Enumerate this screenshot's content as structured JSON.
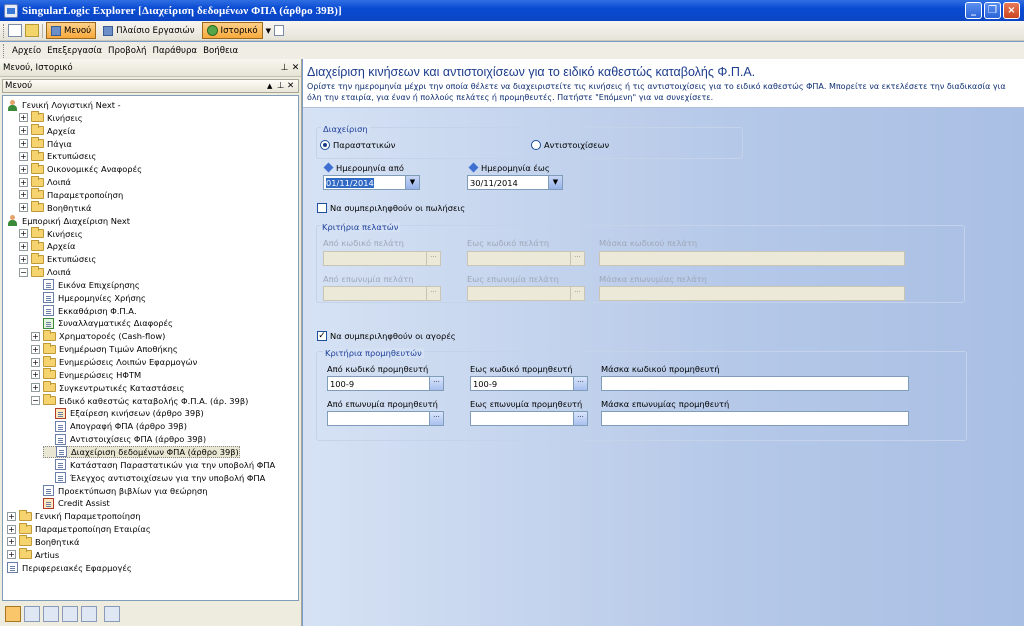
{
  "window": {
    "title": "SingularLogic Explorer [Διαχείριση δεδομένων ΦΠΑ (άρθρο 39Β)]"
  },
  "toolbar": {
    "menu_btn": "Μενού",
    "workspace_btn": "Πλαίσιο Εργασιών",
    "history_btn": "Ιστορικό"
  },
  "menubar": [
    "Αρχείο",
    "Επεξεργασία",
    "Προβολή",
    "Παράθυρα",
    "Βοήθεια"
  ],
  "leftpanel": {
    "header": "Μενού, Ιστορικό",
    "subheader": "Μενού",
    "tree": [
      {
        "label": "Γενική Λογιστική Next -",
        "icon": "person",
        "lvl": 0,
        "exp": ""
      },
      {
        "label": "Κινήσεις",
        "icon": "folder",
        "lvl": 1,
        "exp": "+"
      },
      {
        "label": "Αρχεία",
        "icon": "folder",
        "lvl": 1,
        "exp": "+"
      },
      {
        "label": "Πάγια",
        "icon": "folder",
        "lvl": 1,
        "exp": "+"
      },
      {
        "label": "Εκτυπώσεις",
        "icon": "folder",
        "lvl": 1,
        "exp": "+"
      },
      {
        "label": "Οικονομικές Αναφορές",
        "icon": "folder",
        "lvl": 1,
        "exp": "+"
      },
      {
        "label": "Λοιπά",
        "icon": "folder",
        "lvl": 1,
        "exp": "+"
      },
      {
        "label": "Παραμετροποίηση",
        "icon": "folder",
        "lvl": 1,
        "exp": "+"
      },
      {
        "label": "Βοηθητικά",
        "icon": "folder",
        "lvl": 1,
        "exp": "+"
      },
      {
        "label": "Εμπορική Διαχείριση Next",
        "icon": "person",
        "lvl": 0,
        "exp": ""
      },
      {
        "label": "Κινήσεις",
        "icon": "folder",
        "lvl": 1,
        "exp": "+"
      },
      {
        "label": "Αρχεία",
        "icon": "folder",
        "lvl": 1,
        "exp": "+"
      },
      {
        "label": "Εκτυπώσεις",
        "icon": "folder",
        "lvl": 1,
        "exp": "+"
      },
      {
        "label": "Λοιπά",
        "icon": "folder",
        "lvl": 1,
        "exp": "−"
      },
      {
        "label": "Εικόνα Επιχείρησης",
        "icon": "doc",
        "lvl": 2,
        "exp": ""
      },
      {
        "label": "Ημερομηνίες Χρήσης",
        "icon": "doc",
        "lvl": 2,
        "exp": ""
      },
      {
        "label": "Εκκαθάριση Φ.Π.Α.",
        "icon": "doc",
        "lvl": 2,
        "exp": ""
      },
      {
        "label": "Συναλλαγματικές Διαφορές",
        "icon": "doc-grn",
        "lvl": 2,
        "exp": ""
      },
      {
        "label": "Χρηματοροές (Cash-flow)",
        "icon": "folder",
        "lvl": 2,
        "exp": "+"
      },
      {
        "label": "Ενημέρωση Τιμών Αποθήκης",
        "icon": "folder",
        "lvl": 2,
        "exp": "+"
      },
      {
        "label": "Ενημερώσεις Λοιπών Εφαρμογών",
        "icon": "folder",
        "lvl": 2,
        "exp": "+"
      },
      {
        "label": "Ενημερώσεις ΗΦΤΜ",
        "icon": "folder",
        "lvl": 2,
        "exp": "+"
      },
      {
        "label": "Συγκεντρωτικές Καταστάσεις",
        "icon": "folder",
        "lvl": 2,
        "exp": "+"
      },
      {
        "label": "Ειδικό καθεστώς καταβολής Φ.Π.Α. (άρ. 39β)",
        "icon": "folder",
        "lvl": 2,
        "exp": "−"
      },
      {
        "label": "Εξαίρεση κινήσεων (άρθρο 39β)",
        "icon": "doc-red",
        "lvl": 3,
        "exp": ""
      },
      {
        "label": "Απογραφή ΦΠΑ (άρθρο 39β)",
        "icon": "doc",
        "lvl": 3,
        "exp": ""
      },
      {
        "label": "Αντιστοιχίσεις ΦΠΑ (άρθρο 39β)",
        "icon": "doc",
        "lvl": 3,
        "exp": ""
      },
      {
        "label": "Διαχείριση δεδομένων ΦΠΑ (άρθρο 39β)",
        "icon": "doc",
        "lvl": 3,
        "exp": "",
        "selected": true
      },
      {
        "label": "Κατάσταση Παραστατικών για την υποβολή ΦΠΑ",
        "icon": "doc",
        "lvl": 3,
        "exp": ""
      },
      {
        "label": "Έλεγχος αντιστοιχίσεων για την υποβολή ΦΠΑ",
        "icon": "doc",
        "lvl": 3,
        "exp": ""
      },
      {
        "label": "Προεκτύπωση βιβλίων για θεώρηση",
        "icon": "doc",
        "lvl": 2,
        "exp": ""
      },
      {
        "label": "Credit Assist",
        "icon": "doc-red",
        "lvl": 2,
        "exp": ""
      },
      {
        "label": "Γενική Παραμετροποίηση",
        "icon": "folder",
        "lvl": 0,
        "exp": "+"
      },
      {
        "label": "Παραμετροποίηση Εταιρίας",
        "icon": "folder",
        "lvl": 0,
        "exp": "+"
      },
      {
        "label": "Βοηθητικά",
        "icon": "folder",
        "lvl": 0,
        "exp": "+"
      },
      {
        "label": "Artius",
        "icon": "folder",
        "lvl": 0,
        "exp": "+"
      },
      {
        "label": "Περιφερειακές Εφαρμογές",
        "icon": "doc",
        "lvl": 0,
        "exp": ""
      }
    ]
  },
  "content": {
    "title": "Διαχείριση κινήσεων και αντιστοιχίσεων για το ειδικό καθεστώς καταβολής Φ.Π.Α.",
    "description": "Ορίστε την ημερομηνία μέχρι την οποία θέλετε να διαχειριστείτε τις κινήσεις ή τις αντιστοιχίσεις για το ειδικό καθεστώς ΦΠΑ. Μπορείτε να εκτελέσετε την διαδικασία για όλη την εταιρία, για έναν ή πολλούς πελάτες ή προμηθευτές. Πατήστε \"Επόμενη\" για να συνεχίσετε.",
    "management_label": "Διαχείριση",
    "radio_docs": "Παραστατικών",
    "radio_matches": "Αντιστοιχίσεων",
    "date_from_label": "Ημερομηνία από",
    "date_from": "01/11/2014",
    "date_to_label": "Ημερομηνία έως",
    "date_to": "30/11/2014",
    "include_sales": "Να συμπεριληφθούν οι πωλήσεις",
    "customer_criteria": "Κριτήρια πελατών",
    "cust_code_from": "Από κωδικό πελάτη",
    "cust_code_to": "Εως κωδικό πελάτη",
    "cust_code_mask": "Μάσκα κωδικού πελάτη",
    "cust_name_from": "Από επωνυμία πελάτη",
    "cust_name_to": "Εως επωνυμία πελάτη",
    "cust_name_mask": "Μάσκα επωνυμίας πελάτη",
    "include_purchases": "Να συμπεριληφθούν οι αγορές",
    "supplier_criteria": "Κριτήρια προμηθευτών",
    "sup_code_from": "Από κωδικό προμηθευτή",
    "sup_code_from_val": "100-9",
    "sup_code_to": "Εως κωδικό προμηθευτή",
    "sup_code_to_val": "100-9",
    "sup_code_mask": "Μάσκα κωδικού προμηθευτή",
    "sup_name_from": "Από επωνυμία προμηθευτή",
    "sup_name_to": "Εως επωνυμία προμηθευτή",
    "sup_name_mask": "Μάσκα επωνυμίας προμηθευτή",
    "ellipsis": "···",
    "check": "✓"
  },
  "colors": {
    "title_blue": "#1c3c8c",
    "label_blue": "#1e3f9a",
    "titlebar": "#0a4bd3",
    "active_tab": "#f7a93c"
  }
}
